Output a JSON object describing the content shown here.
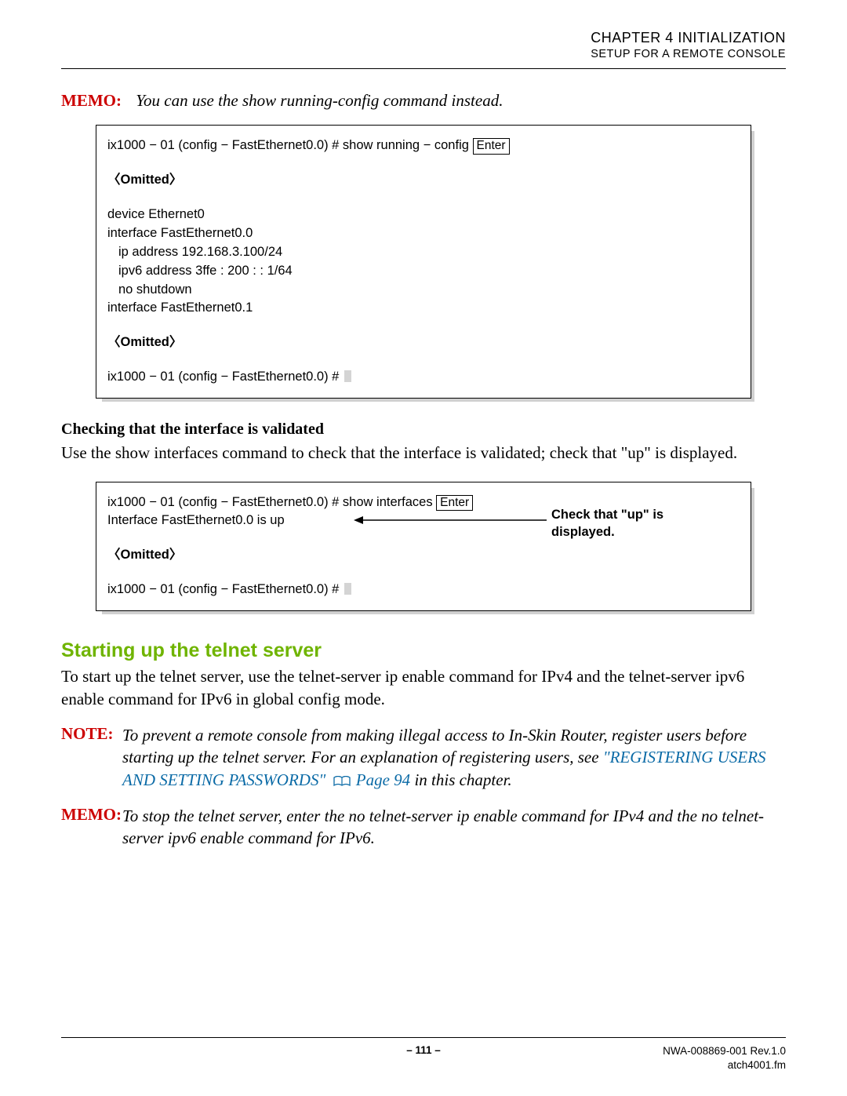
{
  "header": {
    "chapter": "CHAPTER 4   INITIALIZATION",
    "subtitle": "SETUP FOR A REMOTE CONSOLE"
  },
  "memo1": {
    "label": "MEMO:",
    "text": "You can use the show running-config command instead."
  },
  "code1": {
    "l1a": "ix1000 − 01 (config − FastEthernet0.0) # show running − config ",
    "l1_key": "Enter",
    "omitted1": "〈Omitted〉",
    "l3": "device Ethernet0",
    "l4": "interface FastEthernet0.0",
    "l5": "ip address 192.168.3.100/24",
    "l6": "ipv6 address 3ffe : 200 : : 1/64",
    "l7": "no shutdown",
    "l8": "interface FastEthernet0.1",
    "omitted2": "〈Omitted〉",
    "l10": "ix1000 − 01 (config − FastEthernet0.0) # "
  },
  "subhead1": "Checking that the interface is validated",
  "para1": "Use the show interfaces command to check that the interface is validated; check that \"up\" is displayed.",
  "code2": {
    "l1a": "ix1000 − 01 (config − FastEthernet0.0) # show interfaces ",
    "l1_key": "Enter",
    "l2": "Interface FastEthernet0.0 is up",
    "omitted": "〈Omitted〉",
    "l4": "ix1000 − 01 (config − FastEthernet0.0) # ",
    "annot": "Check that \"up\" is displayed."
  },
  "section2": {
    "title": "Starting up the telnet server",
    "para": "To start up the telnet server, use the telnet-server ip enable command for IPv4 and the telnet-server ipv6 enable command for IPv6 in global config mode."
  },
  "note1": {
    "label": "NOTE:",
    "part1": "To prevent a remote console from making illegal access to In-Skin Router, register users before starting up the telnet server. For an explanation of registering users, see ",
    "link": "\"REGISTERING USERS AND SETTING PASSWORDS\"",
    "pageref": " Page 94",
    "part3": " in this chapter."
  },
  "memo2": {
    "label": "MEMO:",
    "text": "To stop the telnet server, enter the no telnet-server ip enable command for IPv4 and the no telnet-server ipv6 enable command for IPv6."
  },
  "footer": {
    "page": "–  111  –",
    "doc1": "NWA-008869-001 Rev.1.0",
    "doc2": "atch4001.fm"
  }
}
